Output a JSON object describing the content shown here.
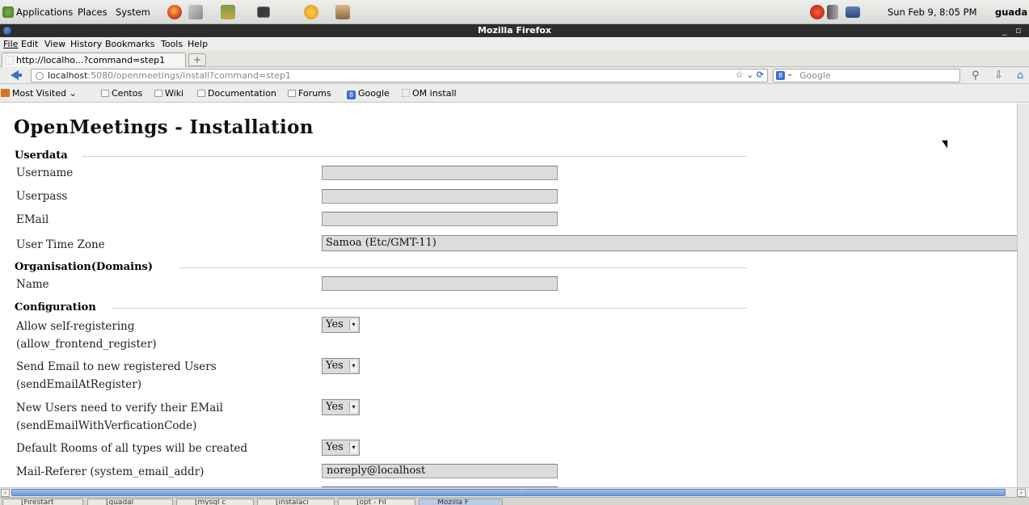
{
  "panel": {
    "applications": "Applications",
    "places": "Places",
    "system": "System",
    "datetime": "Sun Feb  9,  8:05 PM",
    "user": "guada"
  },
  "window": {
    "title": "Mozilla Firefox"
  },
  "menubar": [
    "File",
    "Edit",
    "View",
    "History",
    "Bookmarks",
    "Tools",
    "Help"
  ],
  "tab": {
    "label": "http://localho...?command=step1"
  },
  "navbar": {
    "url_host": "localhost",
    "url_rest": ":5080/openmeetings/install?command=step1",
    "search_engine": "Google"
  },
  "bookmarks": [
    "Most Visited",
    "Centos",
    "Wiki",
    "Documentation",
    "Forums",
    "Google",
    "OM install"
  ],
  "page": {
    "title": "OpenMeetings - Installation",
    "userdata": {
      "legend": "Userdata",
      "username_label": "Username",
      "userpass_label": "Userpass",
      "email_label": "EMail",
      "timezone_label": "User Time Zone",
      "timezone_value": "Samoa (Etc/GMT-11)"
    },
    "organisation": {
      "legend": "Organisation(Domains)",
      "name_label": "Name"
    },
    "configuration": {
      "legend": "Configuration",
      "self_register_label": "Allow self-registering",
      "self_register_key": "(allow_frontend_register)",
      "self_register_value": "Yes",
      "send_email_label": "Send Email to new registered Users",
      "send_email_key": "(sendEmailAtRegister)",
      "send_email_value": "Yes",
      "verify_label": "New Users need to verify their EMail",
      "verify_key": "(sendEmailWithVerficationCode)",
      "verify_value": "Yes",
      "default_rooms_label": "Default Rooms of all types will be created",
      "default_rooms_value": "Yes",
      "mail_referer_label": "Mail-Referer (system_email_addr)",
      "mail_referer_value": "noreply@localhost"
    }
  },
  "taskbar": [
    "[Firestart",
    "[guadal",
    "[mysql c",
    "[instalaci",
    "[opt - Fil",
    "Mozilla F"
  ]
}
